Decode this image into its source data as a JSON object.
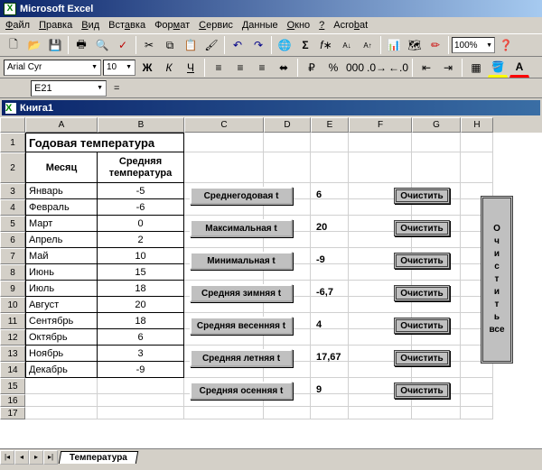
{
  "app": {
    "title": "Microsoft Excel"
  },
  "menu": [
    "Файл",
    "Правка",
    "Вид",
    "Вставка",
    "Формат",
    "Сервис",
    "Данные",
    "Окно",
    "?",
    "Acrobat"
  ],
  "menu_u": [
    "Ф",
    "П",
    "В",
    "Вст",
    "Фор",
    "С",
    "Д",
    "О",
    "",
    "A"
  ],
  "format": {
    "font": "Arial Cyr",
    "size": "10",
    "zoom": "100%"
  },
  "namebox": "E21",
  "book": "Книга1",
  "columns": [
    "A",
    "B",
    "C",
    "D",
    "E",
    "F",
    "G",
    "H"
  ],
  "table": {
    "title": "Годовая температура",
    "h1": "Месяц",
    "h2": "Средняя температура",
    "rows": [
      {
        "m": "Январь",
        "t": "-5"
      },
      {
        "m": "Февраль",
        "t": "-6"
      },
      {
        "m": "Март",
        "t": "0"
      },
      {
        "m": "Апрель",
        "t": "2"
      },
      {
        "m": "Май",
        "t": "10"
      },
      {
        "m": "Июнь",
        "t": "15"
      },
      {
        "m": "Июль",
        "t": "18"
      },
      {
        "m": "Август",
        "t": "20"
      },
      {
        "m": "Сентябрь",
        "t": "18"
      },
      {
        "m": "Октябрь",
        "t": "6"
      },
      {
        "m": "Ноябрь",
        "t": "3"
      },
      {
        "m": "Декабрь",
        "t": "-9"
      }
    ]
  },
  "calc": [
    {
      "label": "Среднегодовая t",
      "val": "6"
    },
    {
      "label": "Максимальная  t",
      "val": "20"
    },
    {
      "label": "Минимальная  t",
      "val": "-9"
    },
    {
      "label": "Средняя зимняя t",
      "val": "-6,7"
    },
    {
      "label": "Средняя весенняя t",
      "val": "4"
    },
    {
      "label": "Средняя летняя t",
      "val": "17,67"
    },
    {
      "label": "Средняя осенняя t",
      "val": "9"
    }
  ],
  "clear": "Очистить",
  "clearall": "Очистить все",
  "clearall_chars": [
    "О",
    "ч",
    "и",
    "с",
    "т",
    "и",
    "т",
    "ь",
    "",
    "все"
  ],
  "sheet_tab": "Температура",
  "chart_data": {
    "type": "table",
    "title": "Годовая температура",
    "categories": [
      "Январь",
      "Февраль",
      "Март",
      "Апрель",
      "Май",
      "Июнь",
      "Июль",
      "Август",
      "Сентябрь",
      "Октябрь",
      "Ноябрь",
      "Декабрь"
    ],
    "values": [
      -5,
      -6,
      0,
      2,
      10,
      15,
      18,
      20,
      18,
      6,
      3,
      -9
    ],
    "aggregates": {
      "mean_year": 6,
      "max": 20,
      "min": -9,
      "mean_winter": -6.7,
      "mean_spring": 4,
      "mean_summer": 17.67,
      "mean_autumn": 9
    }
  }
}
